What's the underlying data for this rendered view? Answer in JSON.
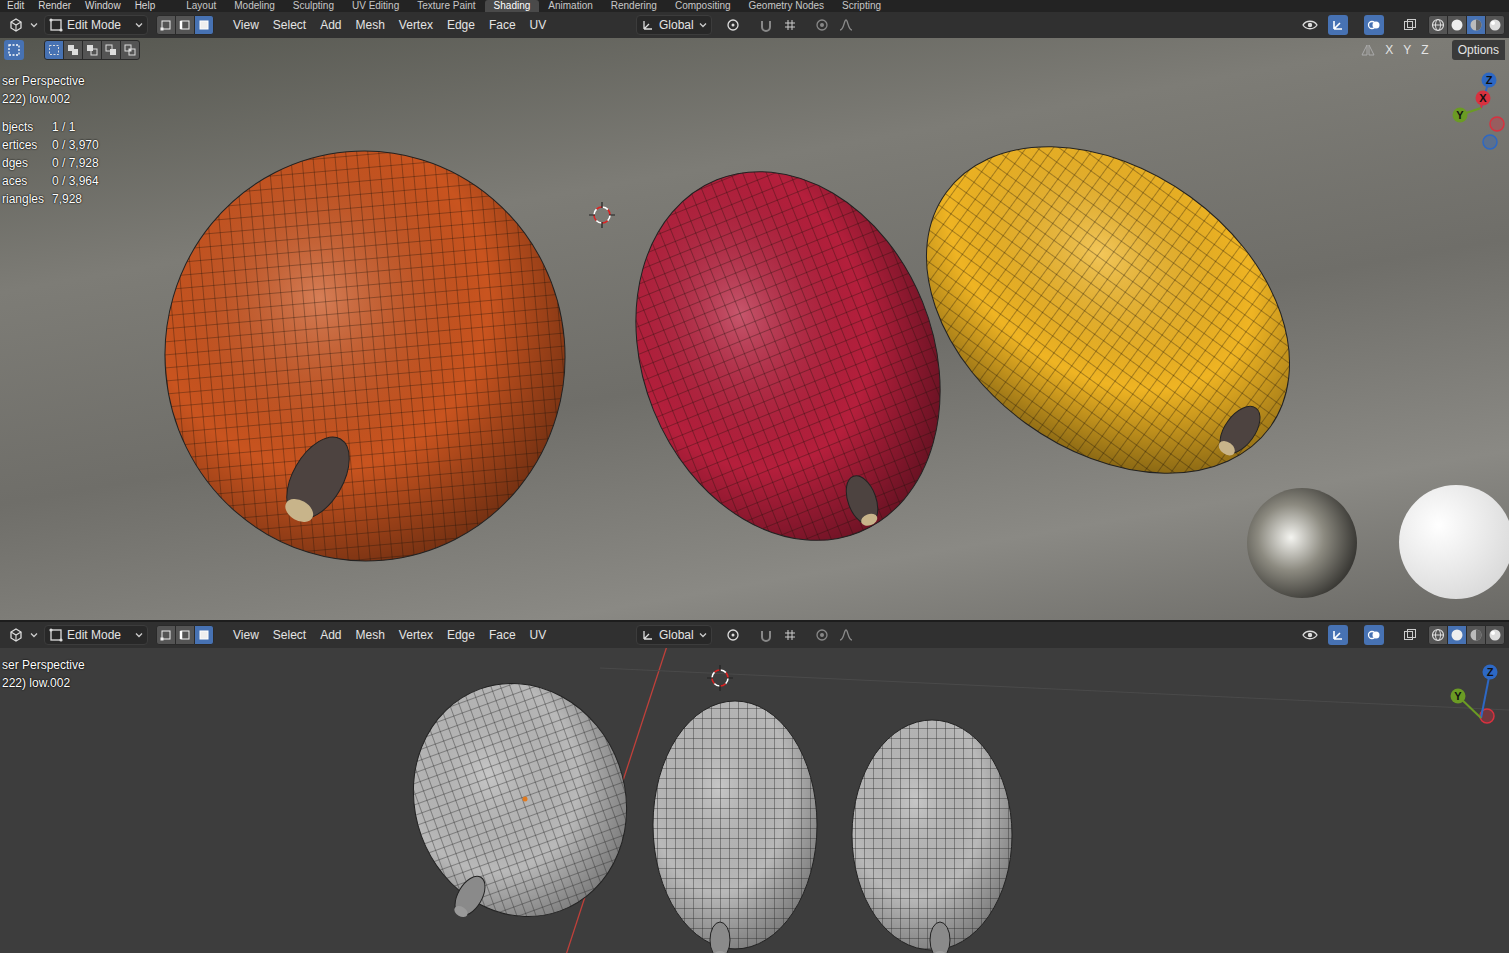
{
  "topbar": {
    "menus": [
      "Edit",
      "Render",
      "Window",
      "Help"
    ],
    "workspaces": [
      {
        "label": "Layout",
        "selected": false
      },
      {
        "label": "Modeling",
        "selected": false
      },
      {
        "label": "Sculpting",
        "selected": false
      },
      {
        "label": "UV Editing",
        "selected": false
      },
      {
        "label": "Texture Paint",
        "selected": false
      },
      {
        "label": "Shading",
        "selected": true
      },
      {
        "label": "Animation",
        "selected": false
      },
      {
        "label": "Rendering",
        "selected": false
      },
      {
        "label": "Compositing",
        "selected": false
      },
      {
        "label": "Geometry Nodes",
        "selected": false
      },
      {
        "label": "Scripting",
        "selected": false
      }
    ]
  },
  "objects": [
    {
      "color": "#c9541f"
    },
    {
      "color": "#b51f3c"
    },
    {
      "color": "#efb423"
    }
  ],
  "viewports": [
    {
      "mode": "Edit Mode",
      "select_modes": [
        {
          "selected": false
        },
        {
          "selected": false
        },
        {
          "selected": true
        }
      ],
      "menus": [
        "View",
        "Select",
        "Add",
        "Mesh",
        "Vertex",
        "Edge",
        "Face",
        "UV"
      ],
      "orientation": "Global",
      "toggles": {
        "gizmos": true,
        "overlays": true,
        "xray": false
      },
      "shading": [
        {
          "selected": false
        },
        {
          "selected": false
        },
        {
          "selected": true
        },
        {
          "selected": false
        }
      ],
      "tool": {
        "box_select": true,
        "modes": [
          {
            "selected": true
          },
          {
            "selected": false
          },
          {
            "selected": false
          },
          {
            "selected": false
          },
          {
            "selected": false
          }
        ],
        "mirror": [
          {
            "label": "X",
            "selected": false
          },
          {
            "label": "Y",
            "selected": false
          },
          {
            "label": "Z",
            "selected": false
          }
        ],
        "options": "Options"
      },
      "overlay": {
        "view": "ser Perspective",
        "object": "222) low.002",
        "stats": [
          {
            "label": "bjects",
            "value": "1 / 1"
          },
          {
            "label": "ertices",
            "value": "0 / 3,970"
          },
          {
            "label": "dges",
            "value": "0 / 7,928"
          },
          {
            "label": "aces",
            "value": "0 / 3,964"
          },
          {
            "label": "riangles",
            "value": "7,928"
          }
        ]
      },
      "gizmo": [
        {
          "label": "Z",
          "color": "#2d68c4"
        },
        {
          "label": "X",
          "color": "#d8313f"
        },
        {
          "label": "Y",
          "color": "#6b9b24"
        }
      ]
    },
    {
      "mode": "Edit Mode",
      "select_modes": [
        {
          "selected": false
        },
        {
          "selected": false
        },
        {
          "selected": true
        }
      ],
      "menus": [
        "View",
        "Select",
        "Add",
        "Mesh",
        "Vertex",
        "Edge",
        "Face",
        "UV"
      ],
      "orientation": "Global",
      "toggles": {
        "gizmos": true,
        "overlays": true,
        "xray": false
      },
      "shading": [
        {
          "selected": false
        },
        {
          "selected": true
        },
        {
          "selected": false
        },
        {
          "selected": false
        }
      ],
      "overlay": {
        "view": "ser Perspective",
        "object": "222) low.002"
      },
      "gizmo": [
        {
          "label": "Z",
          "color": "#2d68c4"
        },
        {
          "label": "Y",
          "color": "#6b9b24"
        }
      ]
    }
  ]
}
